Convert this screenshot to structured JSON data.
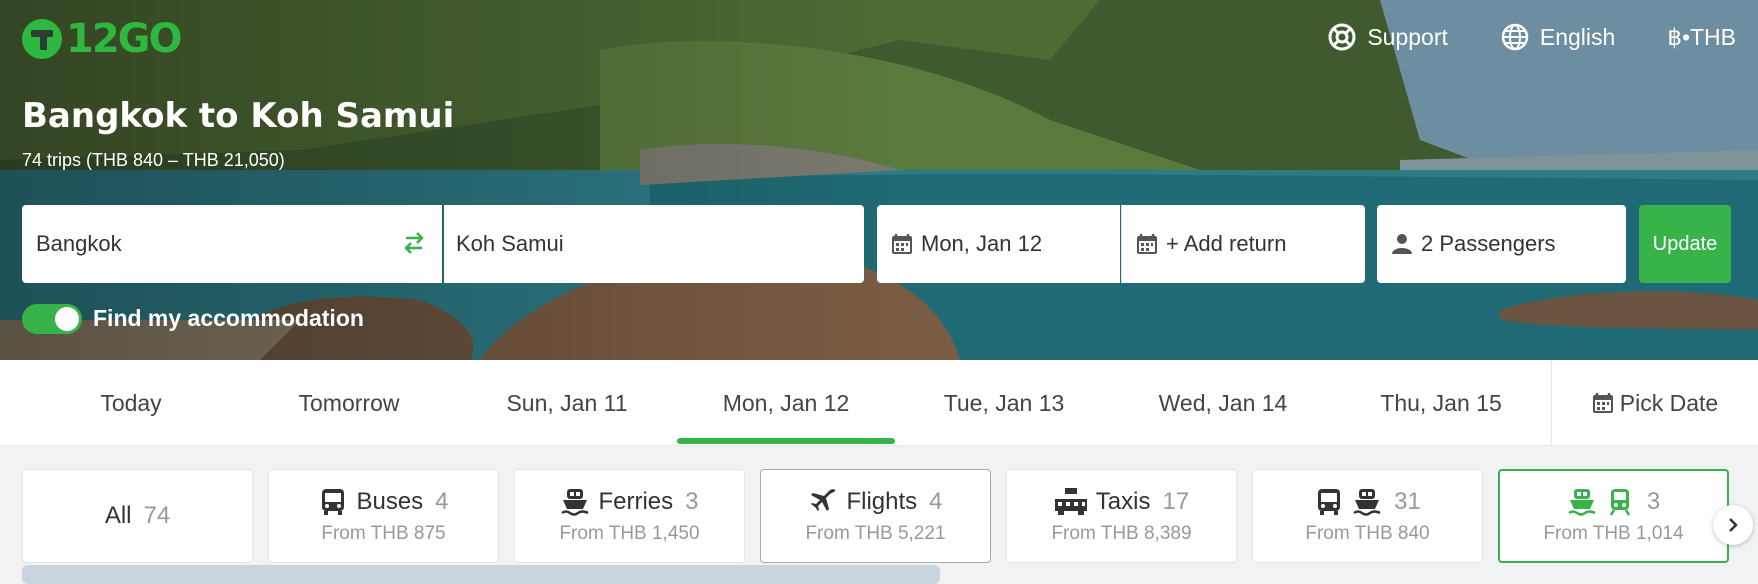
{
  "brand": {
    "logo_text": "12GO"
  },
  "topnav": {
    "support": "Support",
    "language": "English",
    "currency": "฿•THB"
  },
  "route": {
    "title": "Bangkok to Koh Samui",
    "summary": "74 trips (THB 840 – THB 21,050)"
  },
  "search": {
    "from": "Bangkok",
    "to": "Koh Samui",
    "date": "Mon, Jan 12",
    "return": "+ Add return",
    "passengers": "2 Passengers",
    "update": "Update"
  },
  "accommodation_toggle": {
    "label": "Find my accommodation",
    "on": true
  },
  "date_tabs": [
    {
      "label": "Today"
    },
    {
      "label": "Tomorrow"
    },
    {
      "label": "Sun, Jan 11"
    },
    {
      "label": "Mon, Jan 12",
      "active": true
    },
    {
      "label": "Tue, Jan 13"
    },
    {
      "label": "Wed, Jan 14"
    },
    {
      "label": "Thu, Jan 15"
    }
  ],
  "pick_date": "Pick Date",
  "modes": [
    {
      "label": "All",
      "count": "74",
      "from": ""
    },
    {
      "label": "Buses",
      "count": "4",
      "from": "From THB 875"
    },
    {
      "label": "Ferries",
      "count": "3",
      "from": "From THB 1,450"
    },
    {
      "label": "Flights",
      "count": "4",
      "from": "From THB 5,221"
    },
    {
      "label": "Taxis",
      "count": "17",
      "from": "From THB 8,389"
    },
    {
      "label": "",
      "count": "31",
      "from": "From THB 840"
    },
    {
      "label": "",
      "count": "3",
      "from": "From THB 1,014"
    }
  ],
  "colors": {
    "accent": "#37b34a",
    "text": "#333333",
    "muted": "#999999"
  },
  "icons": [
    "support-lifebuoy-icon",
    "globe-icon",
    "swap-icon",
    "calendar-icon",
    "person-icon",
    "bus-icon",
    "ferry-icon",
    "plane-icon",
    "taxi-icon",
    "train-icon",
    "chevron-right-icon"
  ]
}
